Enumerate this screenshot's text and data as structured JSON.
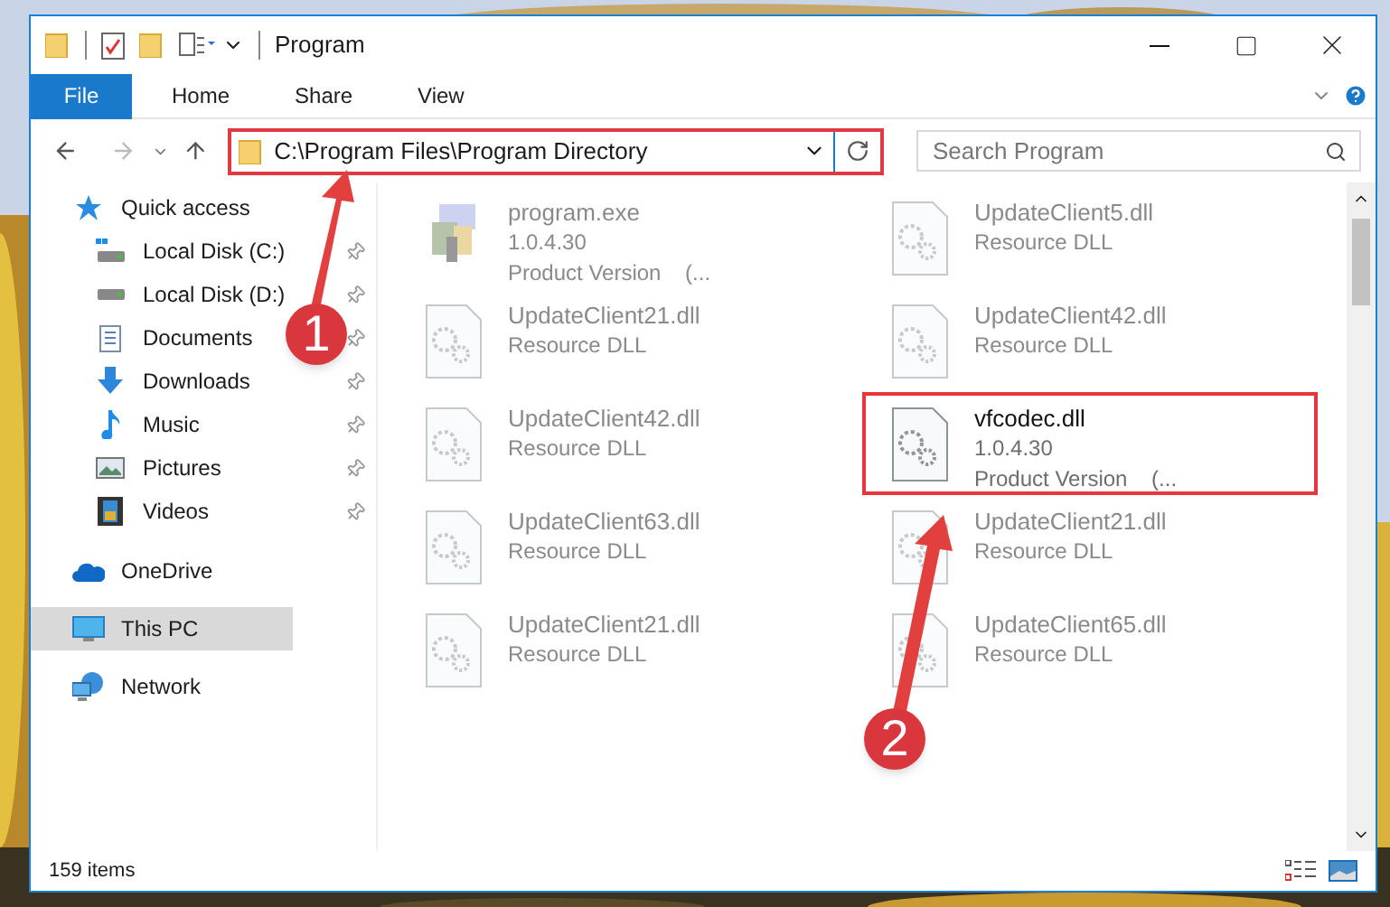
{
  "window": {
    "title": "Program"
  },
  "ribbon_tabs": [
    {
      "label": "File",
      "selected": true
    },
    {
      "label": "Home",
      "selected": false
    },
    {
      "label": "Share",
      "selected": false
    },
    {
      "label": "View",
      "selected": false
    }
  ],
  "address_bar": {
    "path": "C:\\Program Files\\Program Directory",
    "highlighted": true
  },
  "search": {
    "placeholder": "Search Program"
  },
  "sidebar": {
    "items": [
      {
        "label": "Quick access",
        "kind": "quick",
        "selected": false,
        "children": [
          {
            "label": "Local Disk (C:)",
            "kind": "diskc",
            "pinned": true,
            "selected": false
          },
          {
            "label": "Local Disk (D:)",
            "kind": "disk",
            "pinned": true,
            "selected": false
          },
          {
            "label": "Documents",
            "kind": "documents",
            "pinned": true,
            "selected": false
          },
          {
            "label": "Downloads",
            "kind": "downloads",
            "pinned": true,
            "selected": false
          },
          {
            "label": "Music",
            "kind": "music",
            "pinned": true,
            "selected": false
          },
          {
            "label": "Pictures",
            "kind": "pictures",
            "pinned": true,
            "selected": false
          },
          {
            "label": "Videos",
            "kind": "videos",
            "pinned": true,
            "selected": false
          }
        ]
      },
      {
        "label": "OneDrive",
        "kind": "onedrive",
        "selected": false
      },
      {
        "label": "This PC",
        "kind": "pc",
        "selected": true
      },
      {
        "label": "Network",
        "kind": "network",
        "selected": false
      }
    ]
  },
  "files": [
    {
      "name": "program.exe",
      "kind": "exe",
      "lines": [
        "1.0.4.30",
        "Product Version    (..."
      ],
      "blurred": true,
      "highlighted": false
    },
    {
      "name": "UpdateClient5.dll",
      "kind": "dll",
      "lines": [
        "Resource DLL"
      ],
      "blurred": true,
      "highlighted": false
    },
    {
      "name": "UpdateClient21.dll",
      "kind": "dll",
      "lines": [
        "Resource DLL"
      ],
      "blurred": true,
      "highlighted": false
    },
    {
      "name": "UpdateClient42.dll",
      "kind": "dll",
      "lines": [
        "Resource DLL"
      ],
      "blurred": true,
      "highlighted": false
    },
    {
      "name": "UpdateClient42.dll",
      "kind": "dll",
      "lines": [
        "Resource DLL"
      ],
      "blurred": true,
      "highlighted": false
    },
    {
      "name": "vfcodec.dll",
      "kind": "dll",
      "lines": [
        "1.0.4.30",
        "Product Version    (..."
      ],
      "blurred": false,
      "highlighted": true
    },
    {
      "name": "UpdateClient63.dll",
      "kind": "dll",
      "lines": [
        "Resource DLL"
      ],
      "blurred": true,
      "highlighted": false
    },
    {
      "name": "UpdateClient21.dll",
      "kind": "dll",
      "lines": [
        "Resource DLL"
      ],
      "blurred": true,
      "highlighted": false
    },
    {
      "name": "UpdateClient21.dll",
      "kind": "dll",
      "lines": [
        "Resource DLL"
      ],
      "blurred": true,
      "highlighted": false
    },
    {
      "name": "UpdateClient65.dll",
      "kind": "dll",
      "lines": [
        "Resource DLL"
      ],
      "blurred": true,
      "highlighted": false
    }
  ],
  "status_bar": {
    "count": "159 items"
  },
  "callouts": [
    {
      "number": "1"
    },
    {
      "number": "2"
    }
  ]
}
